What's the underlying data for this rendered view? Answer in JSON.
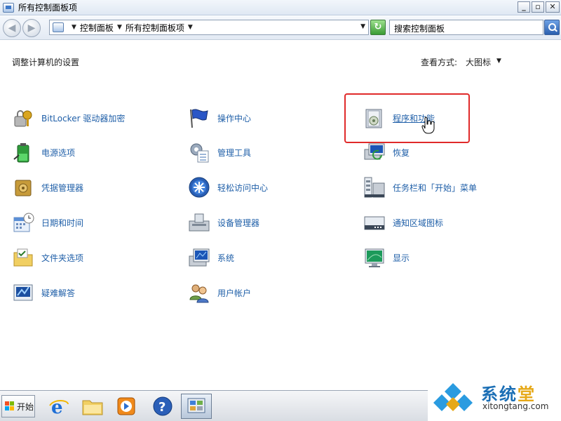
{
  "window": {
    "title": "所有控制面板项",
    "minimize": "_",
    "maximize": "▫",
    "close": "✕"
  },
  "address": {
    "crumbs": [
      "控制面板",
      "所有控制面板项"
    ],
    "search_placeholder": "搜索控制面板"
  },
  "content": {
    "heading": "调整计算机的设置",
    "view_by_label": "查看方式:",
    "view_by_value": "大图标"
  },
  "items": [
    {
      "label": "BitLocker 驱动器加密",
      "icon": "key-lock-icon"
    },
    {
      "label": "操作中心",
      "icon": "flag-icon"
    },
    {
      "label": "程序和功能",
      "icon": "programs-features-icon",
      "hover": true
    },
    {
      "label": "电源选项",
      "icon": "battery-icon"
    },
    {
      "label": "管理工具",
      "icon": "admin-tools-icon"
    },
    {
      "label": "恢复",
      "icon": "recovery-icon"
    },
    {
      "label": "凭据管理器",
      "icon": "credential-vault-icon"
    },
    {
      "label": "轻松访问中心",
      "icon": "ease-of-access-icon"
    },
    {
      "label": "任务栏和「开始」菜单",
      "icon": "taskbar-icon"
    },
    {
      "label": "日期和时间",
      "icon": "calendar-clock-icon"
    },
    {
      "label": "设备管理器",
      "icon": "device-manager-icon"
    },
    {
      "label": "通知区域图标",
      "icon": "notification-area-icon"
    },
    {
      "label": "文件夹选项",
      "icon": "folder-options-icon"
    },
    {
      "label": "系统",
      "icon": "system-icon"
    },
    {
      "label": "显示",
      "icon": "display-icon"
    },
    {
      "label": "疑难解答",
      "icon": "troubleshoot-icon"
    },
    {
      "label": "用户帐户",
      "icon": "user-accounts-icon"
    }
  ],
  "taskbar": {
    "start_label": "开始",
    "buttons": [
      "internet-explorer-icon",
      "windows-explorer-icon",
      "media-player-icon",
      "help-icon",
      "control-panel-icon"
    ]
  },
  "watermark": {
    "title_main": "系统",
    "title_accent": "堂",
    "url": "xitongtang.com"
  }
}
